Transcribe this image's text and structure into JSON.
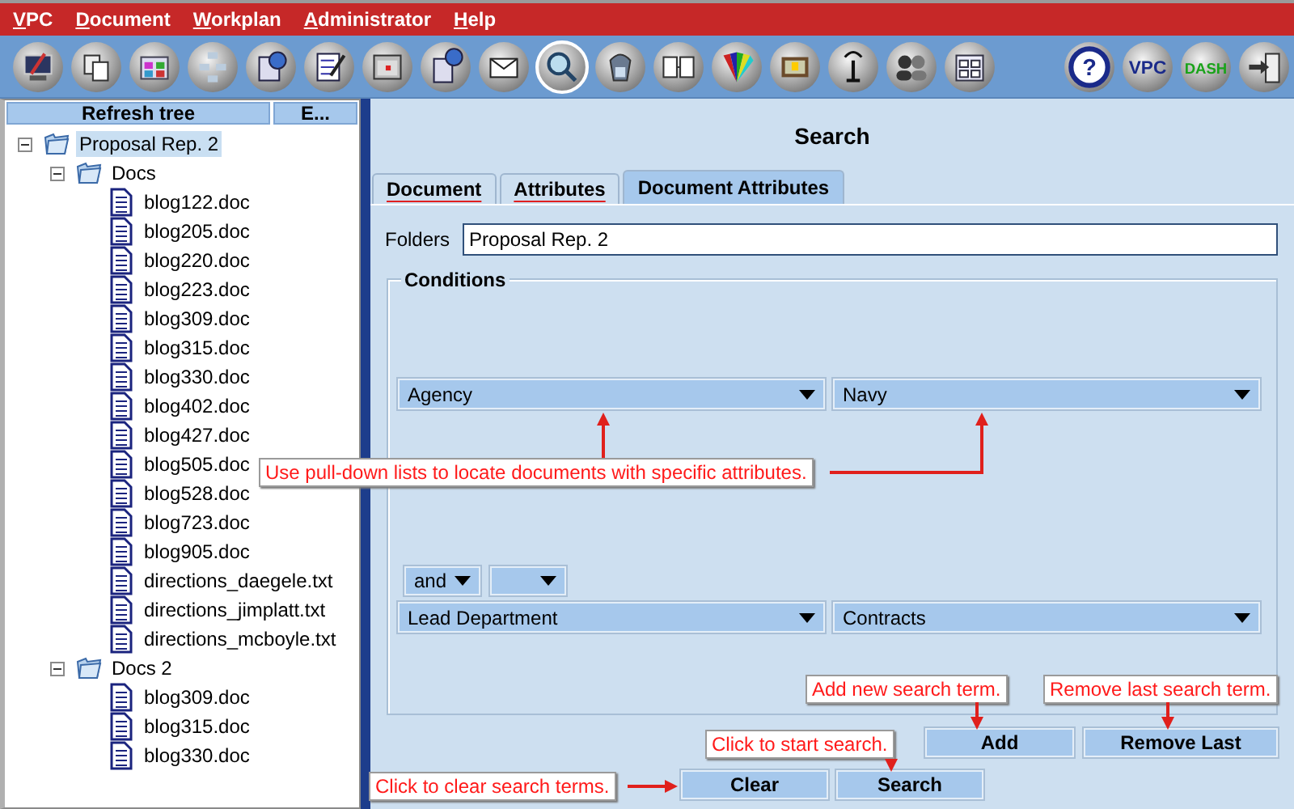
{
  "menu": [
    "VPC",
    "Document",
    "Workplan",
    "Administrator",
    "Help"
  ],
  "toolbar": {
    "left": [
      {
        "kind": "monitor",
        "selected": false
      },
      {
        "kind": "copies",
        "selected": false
      },
      {
        "kind": "folder",
        "selected": false
      },
      {
        "kind": "network",
        "selected": false
      },
      {
        "kind": "globe",
        "selected": false
      },
      {
        "kind": "notepad",
        "selected": false
      },
      {
        "kind": "calendar",
        "selected": false
      },
      {
        "kind": "docglobe",
        "selected": false
      },
      {
        "kind": "envelope",
        "selected": false
      },
      {
        "kind": "magnifier",
        "selected": true
      },
      {
        "kind": "figure",
        "selected": false
      },
      {
        "kind": "columns",
        "selected": false
      },
      {
        "kind": "fan",
        "selected": false
      },
      {
        "kind": "frame",
        "selected": false
      },
      {
        "kind": "antenna",
        "selected": false
      },
      {
        "kind": "people",
        "selected": false
      },
      {
        "kind": "grid",
        "selected": false
      }
    ],
    "right": [
      {
        "kind": "help",
        "label": "?",
        "selected": false
      },
      {
        "kind": "vpc",
        "label": "VPC",
        "selected": false
      },
      {
        "kind": "dash",
        "label": "DASH",
        "selected": false
      },
      {
        "kind": "exit",
        "selected": false
      }
    ]
  },
  "tree": {
    "header_buttons": [
      "Refresh tree",
      "E..."
    ],
    "nodes": [
      {
        "label": "Proposal Rep. 2",
        "kind": "folder",
        "expanded": true,
        "selected": true,
        "children": [
          {
            "label": "Docs",
            "kind": "folder",
            "expanded": true,
            "selected": false,
            "children": [
              {
                "label": "blog122.doc",
                "kind": "file",
                "selected": false
              },
              {
                "label": "blog205.doc",
                "kind": "file",
                "selected": false
              },
              {
                "label": "blog220.doc",
                "kind": "file",
                "selected": false
              },
              {
                "label": "blog223.doc",
                "kind": "file",
                "selected": false
              },
              {
                "label": "blog309.doc",
                "kind": "file",
                "selected": false
              },
              {
                "label": "blog315.doc",
                "kind": "file",
                "selected": false
              },
              {
                "label": "blog330.doc",
                "kind": "file",
                "selected": false
              },
              {
                "label": "blog402.doc",
                "kind": "file",
                "selected": false
              },
              {
                "label": "blog427.doc",
                "kind": "file",
                "selected": false
              },
              {
                "label": "blog505.doc",
                "kind": "file",
                "selected": false
              },
              {
                "label": "blog528.doc",
                "kind": "file",
                "selected": false
              },
              {
                "label": "blog723.doc",
                "kind": "file",
                "selected": false
              },
              {
                "label": "blog905.doc",
                "kind": "file",
                "selected": false
              },
              {
                "label": "directions_daegele.txt",
                "kind": "file",
                "selected": false
              },
              {
                "label": "directions_jimplatt.txt",
                "kind": "file",
                "selected": false
              },
              {
                "label": "directions_mcboyle.txt",
                "kind": "file",
                "selected": false
              }
            ]
          },
          {
            "label": "Docs 2",
            "kind": "folder",
            "expanded": true,
            "selected": false,
            "children": [
              {
                "label": "blog309.doc",
                "kind": "file",
                "selected": false
              },
              {
                "label": "blog315.doc",
                "kind": "file",
                "selected": false
              },
              {
                "label": "blog330.doc",
                "kind": "file",
                "selected": false
              }
            ]
          }
        ]
      }
    ]
  },
  "search": {
    "title": "Search",
    "tabs": [
      {
        "label": "Document",
        "selected": false,
        "marked": true
      },
      {
        "label": "Attributes",
        "selected": false,
        "marked": true
      },
      {
        "label": "Document Attributes",
        "selected": true,
        "marked": false
      }
    ],
    "folders_label": "Folders",
    "folders_value": "Proposal Rep. 2",
    "conditions_title": "Conditions",
    "conditions": [
      {
        "attribute": "Agency",
        "value": "Navy"
      },
      {
        "operator": "and",
        "attribute": "Lead Department",
        "value": "Contracts"
      }
    ],
    "buttons": [
      "Add",
      "Remove Last"
    ],
    "bottom_buttons": [
      "Clear",
      "Search"
    ]
  },
  "callouts": [
    "Use pull-down lists to locate documents with specific attributes.",
    "Add new search term.",
    "Remove last search term.",
    "Click to start search.",
    "Click to clear search terms."
  ]
}
